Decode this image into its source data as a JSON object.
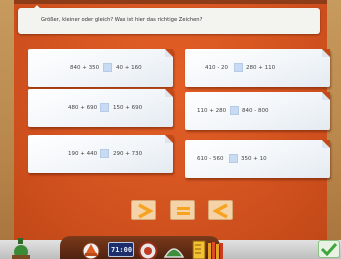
{
  "instruction": "Größer, kleiner oder gleich? Was ist hier das richtige Zeichen?",
  "tasks": [
    {
      "left": "840 + 350",
      "right": "40 + 160"
    },
    {
      "left": "410 - 20",
      "right": "280 + 110"
    },
    {
      "left": "480 + 690",
      "right": "150 + 690"
    },
    {
      "left": "110 + 280",
      "right": "840 - 800"
    },
    {
      "left": "190 + 440",
      "right": "290 + 730"
    },
    {
      "left": "610 - 560",
      "right": "350 + 10"
    }
  ],
  "answer_tiles": [
    {
      "symbol": "greater-than-icon"
    },
    {
      "symbol": "equals-icon"
    },
    {
      "symbol": "less-than-icon"
    }
  ],
  "toolbar": {
    "clock_display": "71:00"
  },
  "colors": {
    "board": "#d45420",
    "tile_bg": "#f4d3a9",
    "symbol": "#f6a321",
    "slot": "#c9dbf2",
    "check": "#3ea63a"
  }
}
